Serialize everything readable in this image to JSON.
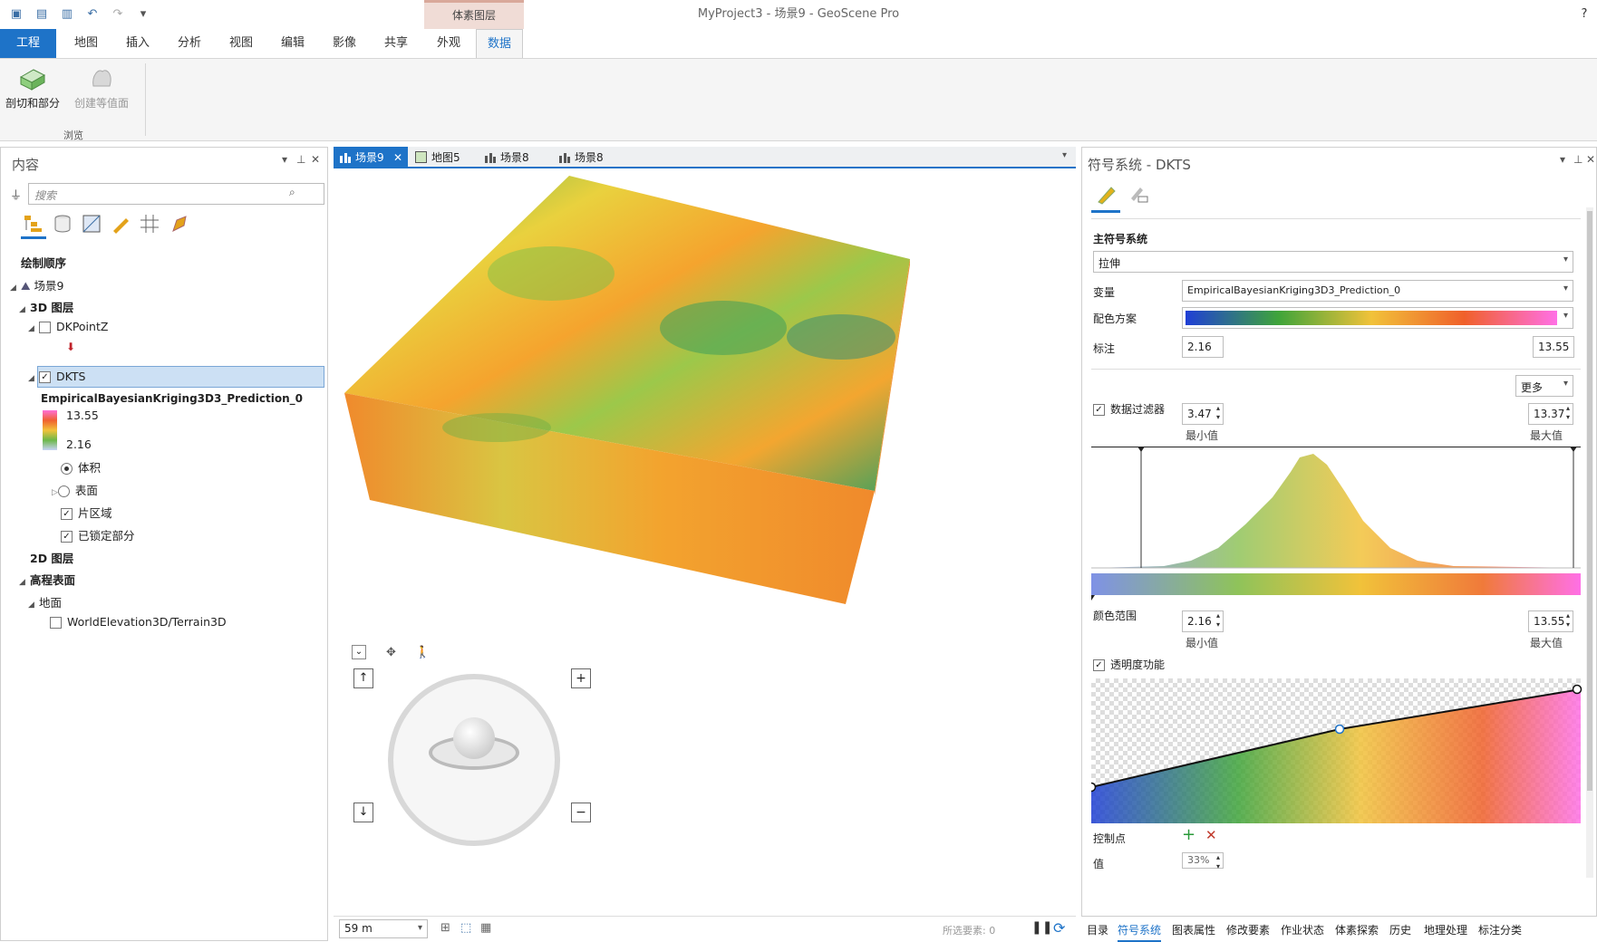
{
  "app": {
    "title": "MyProject3 - 场景9 - GeoScene Pro",
    "context_header": "体素图层"
  },
  "ribbon": {
    "tabs": [
      "工程",
      "地图",
      "插入",
      "分析",
      "视图",
      "编辑",
      "影像",
      "共享",
      "外观",
      "数据"
    ],
    "active_tab": "数据",
    "buttons": [
      {
        "label": "剖切和部分",
        "icon": "section-icon",
        "enabled": true
      },
      {
        "label": "创建等值面",
        "icon": "isosurface-icon",
        "enabled": false
      }
    ],
    "group_label": "浏览"
  },
  "contents": {
    "title": "内容",
    "search_placeholder": "搜索",
    "drawing_order": "绘制顺序",
    "scene": "场景9",
    "layers_3d": "3D 图层",
    "layer_point": "DKPointZ",
    "layer_voxel": "DKTS",
    "variable": "EmpiricalBayesianKriging3D3_Prediction_0",
    "legend_max": "13.55",
    "legend_min": "2.16",
    "volume": "体积",
    "surface": "表面",
    "sections": "片区域",
    "locked_sections": "已锁定部分",
    "layers_2d": "2D 图层",
    "elevation": "高程表面",
    "ground": "地面",
    "elevation_source": "WorldElevation3D/Terrain3D"
  },
  "view": {
    "tabs": [
      {
        "label": "场景9",
        "icon": "scene-icon",
        "active": true
      },
      {
        "label": "地图5",
        "icon": "map-icon",
        "active": false
      },
      {
        "label": "场景8",
        "icon": "scene-icon",
        "active": false
      },
      {
        "label": "场景8",
        "icon": "scene-icon",
        "active": false
      }
    ],
    "scale": "59 m",
    "selected_features": "所选要素: 0"
  },
  "symbology": {
    "title": "符号系统 - DKTS",
    "primary": "主符号系统",
    "method": "拉伸",
    "variable_label": "变量",
    "variable": "EmpiricalBayesianKriging3D3_Prediction_0",
    "color_scheme_label": "配色方案",
    "labels_label": "标注",
    "label_min": "2.16",
    "label_max": "13.55",
    "more": "更多",
    "data_filter": "数据过滤器",
    "filter_min": "3.47",
    "filter_max": "13.37",
    "min_label": "最小值",
    "max_label": "最大值",
    "color_range": "颜色范围",
    "range_min": "2.16",
    "range_max": "13.55",
    "transparency": "透明度功能",
    "control_points": "控制点",
    "value_label": "值",
    "value": "33%",
    "colors": {
      "low": "#1f3fd6",
      "mid1": "#3fa43a",
      "mid2": "#f1c23a",
      "mid3": "#f0602a",
      "high": "#ff70e6"
    }
  },
  "bottom_tabs": [
    "目录",
    "符号系统",
    "图表属性",
    "修改要素",
    "作业状态",
    "体素探索",
    "历史",
    "地理处理",
    "标注分类"
  ],
  "bottom_active": "符号系统"
}
